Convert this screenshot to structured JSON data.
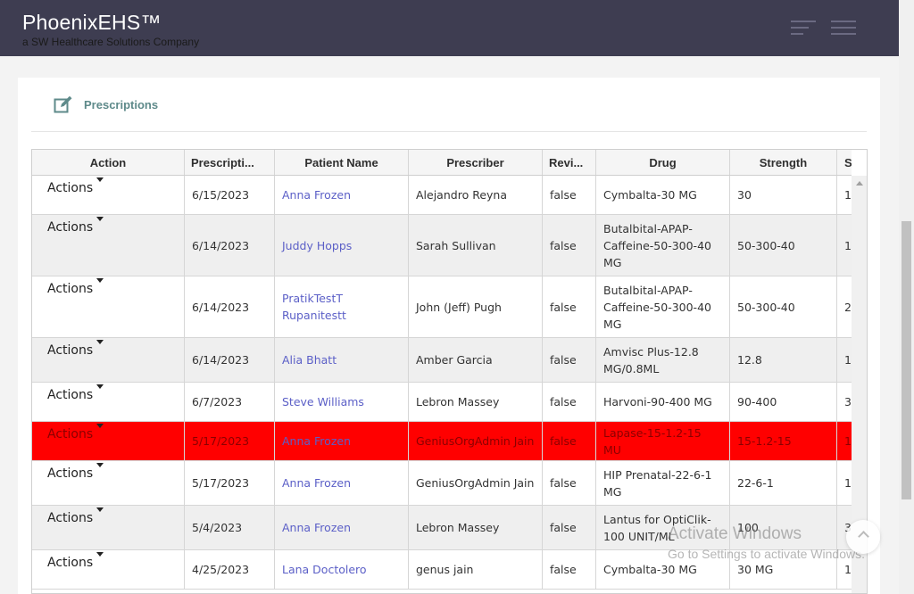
{
  "header": {
    "brand_title": "PhoenixEHS™",
    "brand_subtitle": "a SW Healthcare Solutions Company"
  },
  "card": {
    "title": "Prescriptions"
  },
  "grid": {
    "columns": [
      "Action",
      "Prescripti...",
      "Patient Name",
      "Prescriber",
      "Revi...",
      "Drug",
      "Strength",
      "S"
    ],
    "rows": [
      {
        "action": "Actions",
        "date": "6/15/2023",
        "patient": "Anna Frozen",
        "prescriber": "Alejandro Reyna",
        "reviewed": "false",
        "drug": "Cymbalta-30 MG",
        "strength": "30",
        "s": "1"
      },
      {
        "action": "Actions",
        "date": "6/14/2023",
        "patient": "Juddy Hopps",
        "prescriber": "Sarah Sullivan",
        "reviewed": "false",
        "drug": "Butalbital-APAP-Caffeine-50-300-40 MG",
        "strength": "50-300-40",
        "s": "1"
      },
      {
        "action": "Actions",
        "date": "6/14/2023",
        "patient": "PratikTestT Rupanitestt",
        "prescriber": "John (Jeff) Pugh",
        "reviewed": "false",
        "drug": "Butalbital-APAP-Caffeine-50-300-40 MG",
        "strength": "50-300-40",
        "s": "2"
      },
      {
        "action": "Actions",
        "date": "6/14/2023",
        "patient": "Alia Bhatt",
        "prescriber": "Amber Garcia",
        "reviewed": "false",
        "drug": "Amvisc Plus-12.8 MG/0.8ML",
        "strength": "12.8",
        "s": "1"
      },
      {
        "action": "Actions",
        "date": "6/7/2023",
        "patient": "Steve Williams",
        "prescriber": "Lebron Massey",
        "reviewed": "false",
        "drug": "Harvoni-90-400 MG",
        "strength": "90-400",
        "s": "3"
      },
      {
        "action": "Actions",
        "date": "5/17/2023",
        "patient": "Anna Frozen",
        "prescriber": "GeniusOrgAdmin Jain",
        "reviewed": "false",
        "drug": "Lapase-15-1.2-15 MU",
        "strength": "15-1.2-15",
        "s": "1",
        "flagged": true
      },
      {
        "action": "Actions",
        "date": "5/17/2023",
        "patient": "Anna Frozen",
        "prescriber": "GeniusOrgAdmin Jain",
        "reviewed": "false",
        "drug": "HIP Prenatal-22-6-1 MG",
        "strength": "22-6-1",
        "s": "1"
      },
      {
        "action": "Actions",
        "date": "5/4/2023",
        "patient": "Anna Frozen",
        "prescriber": "Lebron Massey",
        "reviewed": "false",
        "drug": "Lantus for OptiClik-100 UNIT/ML",
        "strength": "100",
        "s": "3"
      },
      {
        "action": "Actions",
        "date": "4/25/2023",
        "patient": "Lana Doctolero",
        "prescriber": "genus jain",
        "reviewed": "false",
        "drug": "Cymbalta-30 MG",
        "strength": "30 MG",
        "s": "1"
      }
    ]
  },
  "watermark": {
    "line1": "Activate Windows",
    "line2": "Go to Settings to activate Windows."
  },
  "colors": {
    "header_bg": "#3e3d51",
    "link": "#5b5fc7",
    "flag_row": "#ff0000",
    "title_teal": "#5e8a8a"
  }
}
